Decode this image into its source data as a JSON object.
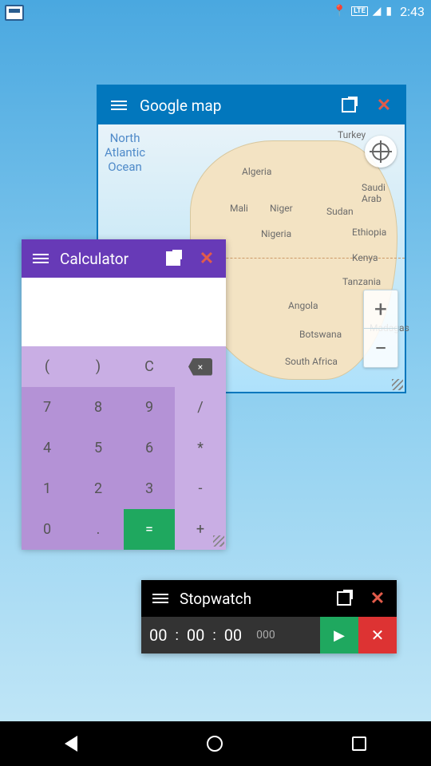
{
  "statusbar": {
    "lte": "LTE",
    "time": "2:43"
  },
  "map": {
    "title": "Google map",
    "ocean_label": "North\nAtlantic\nOcean",
    "labels": {
      "turkey": "Turkey",
      "algeria": "Algeria",
      "saudi": "Saudi Arab",
      "mali": "Mali",
      "niger": "Niger",
      "sudan": "Sudan",
      "nigeria": "Nigeria",
      "ethiopia": "Ethiopia",
      "kenya": "Kenya",
      "tanzania": "Tanzania",
      "angola": "Angola",
      "botswana": "Botswana",
      "south_africa": "South Africa",
      "madagascar": "Madagas"
    },
    "zoom_in": "+",
    "zoom_out": "−"
  },
  "calculator": {
    "title": "Calculator",
    "func": {
      "lparen": "(",
      "rparen": ")",
      "clear": "C"
    },
    "keys": {
      "k7": "7",
      "k8": "8",
      "k9": "9",
      "div": "/",
      "k4": "4",
      "k5": "5",
      "k6": "6",
      "mul": "*",
      "k1": "1",
      "k2": "2",
      "k3": "3",
      "sub": "-",
      "k0": "0",
      "dot": ".",
      "eq": "=",
      "add": "+"
    },
    "backspace": "×"
  },
  "stopwatch": {
    "title": "Stopwatch",
    "h": "00",
    "m": "00",
    "s": "00",
    "ms": "000",
    "colon": ":"
  }
}
